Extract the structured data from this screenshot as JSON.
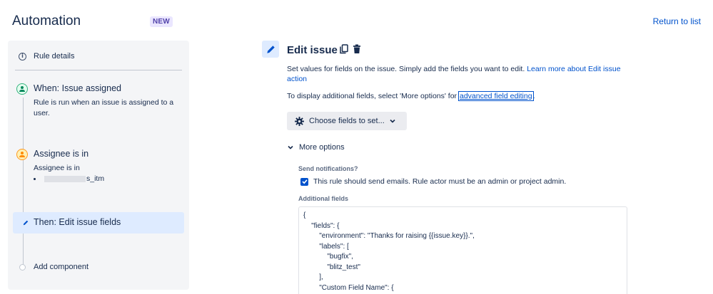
{
  "header": {
    "title": "Automation",
    "badge": "NEW",
    "return_link": "Return to list"
  },
  "sidebar": {
    "rule_details": "Rule details",
    "steps": [
      {
        "title": "When: Issue assigned",
        "description": "Rule is run when an issue is assigned to a user.",
        "icon": "person-icon"
      },
      {
        "title": "Assignee is in",
        "description": "Assignee is in",
        "bullet": "s_itm",
        "icon": "person-icon"
      },
      {
        "title": "Then: Edit issue fields",
        "icon": "pencil-icon"
      }
    ],
    "add_component": "Add component"
  },
  "main": {
    "title": "Edit issue",
    "description_text": "Set values for fields on the issue. Simply add the fields you want to edit.",
    "description_link": "Learn more about Edit issue action",
    "display_text": "To display additional fields, select 'More options' for",
    "advanced_link": "advanced field editing",
    "display_suffix": ".",
    "choose_button": "Choose fields to set...",
    "more_options": "More options",
    "send_notifications_label": "Send notifications?",
    "send_notifications_text": "This rule should send emails. Rule actor must be an admin or project admin.",
    "send_notifications_checked": true,
    "additional_fields_label": "Additional fields",
    "code_lines": [
      "{",
      "    \"fields\": {",
      "        \"environment\": \"Thanks for raising {{issue.key}}.\",",
      "        \"labels\": [",
      "            \"bugfix\",",
      "            \"blitz_test\"",
      "        ],",
      "        \"Custom Field Name\": {"
    ]
  },
  "colors": {
    "accent": "#0052cc",
    "selected_bg": "#deebff",
    "panel_bg": "#f4f5f7",
    "trigger_green": "#36b37e",
    "condition_orange": "#ff991f",
    "badge_purple": "#5243aa"
  }
}
